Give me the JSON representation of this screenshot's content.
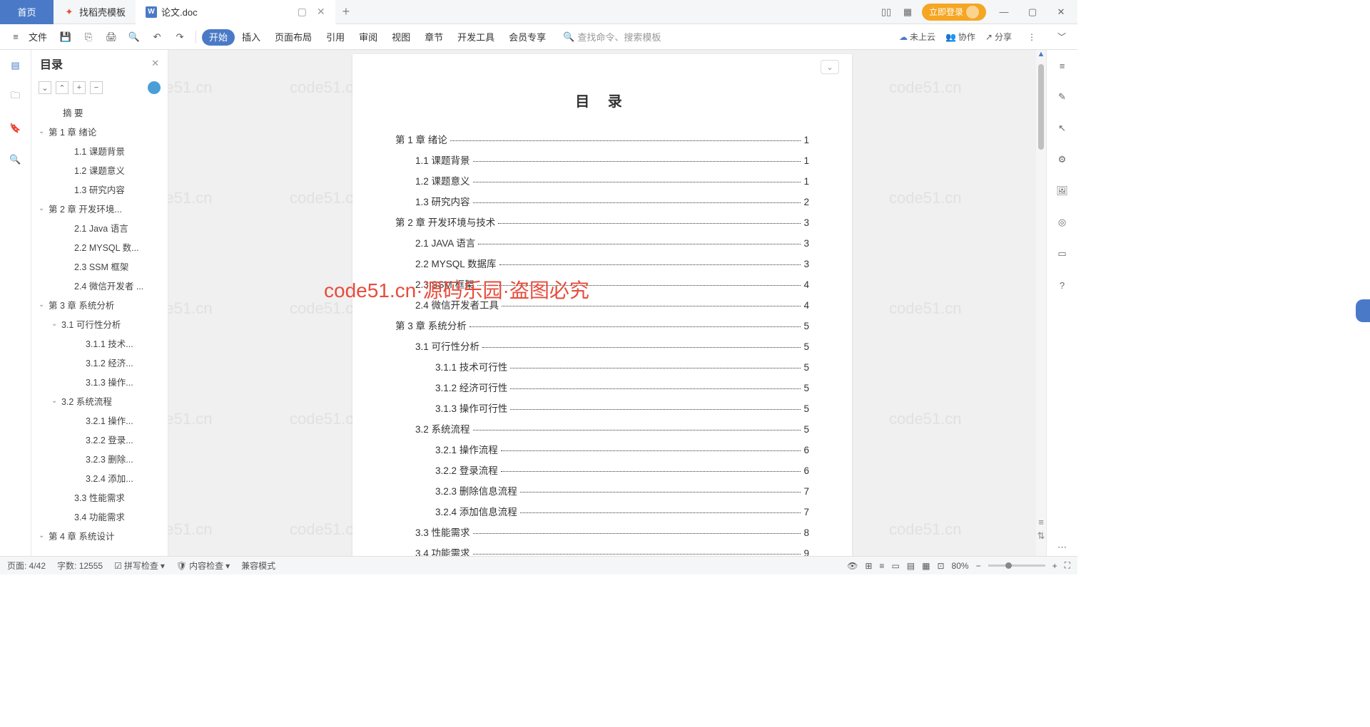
{
  "tabs": {
    "home": "首页",
    "template": "找稻壳模板",
    "doc": "论文.doc"
  },
  "login_label": "立即登录",
  "file_label": "文件",
  "menu": [
    "开始",
    "插入",
    "页面布局",
    "引用",
    "审阅",
    "视图",
    "章节",
    "开发工具",
    "会员专享"
  ],
  "search_placeholder": "查找命令、搜索模板",
  "cloud_label": "未上云",
  "collab_label": "协作",
  "share_label": "分享",
  "outline_title": "目录",
  "outline": [
    {
      "t": "摘 要",
      "l": 1
    },
    {
      "t": "第 1 章  绪论",
      "l": 0,
      "c": true
    },
    {
      "t": "1.1 课题背景",
      "l": 2
    },
    {
      "t": "1.2 课题意义",
      "l": 2
    },
    {
      "t": "1.3 研究内容",
      "l": 2
    },
    {
      "t": "第 2 章  开发环境...",
      "l": 0,
      "c": true
    },
    {
      "t": "2.1 Java 语言",
      "l": 2
    },
    {
      "t": "2.2 MYSQL 数...",
      "l": 2
    },
    {
      "t": "2.3 SSM 框架",
      "l": 2
    },
    {
      "t": "2.4 微信开发者 ...",
      "l": 2
    },
    {
      "t": "第 3 章  系统分析",
      "l": 0,
      "c": true
    },
    {
      "t": "3.1 可行性分析",
      "l": 1,
      "c": true
    },
    {
      "t": "3.1.1 技术...",
      "l": 3
    },
    {
      "t": "3.1.2 经济...",
      "l": 3
    },
    {
      "t": "3.1.3 操作...",
      "l": 3
    },
    {
      "t": "3.2 系统流程",
      "l": 1,
      "c": true
    },
    {
      "t": "3.2.1 操作...",
      "l": 3
    },
    {
      "t": "3.2.2 登录...",
      "l": 3
    },
    {
      "t": "3.2.3 删除...",
      "l": 3
    },
    {
      "t": "3.2.4 添加...",
      "l": 3
    },
    {
      "t": "3.3 性能需求",
      "l": 2
    },
    {
      "t": "3.4 功能需求",
      "l": 2
    },
    {
      "t": "第 4 章  系统设计",
      "l": 0,
      "c": true
    }
  ],
  "toc_title": "目  录",
  "toc": [
    {
      "t": "第 1 章  绪论",
      "p": "1",
      "l": 0
    },
    {
      "t": "1.1 课题背景",
      "p": "1",
      "l": 1
    },
    {
      "t": "1.2 课题意义",
      "p": "1",
      "l": 1
    },
    {
      "t": "1.3 研究内容",
      "p": "2",
      "l": 1
    },
    {
      "t": "第 2 章  开发环境与技术",
      "p": "3",
      "l": 0
    },
    {
      "t": "2.1 JAVA 语言",
      "p": "3",
      "l": 1
    },
    {
      "t": "2.2 MYSQL 数据库",
      "p": "3",
      "l": 1
    },
    {
      "t": "2.3 SSM 框架",
      "p": "4",
      "l": 1
    },
    {
      "t": "2.4 微信开发者工具",
      "p": "4",
      "l": 1
    },
    {
      "t": "第 3 章  系统分析",
      "p": "5",
      "l": 0
    },
    {
      "t": "3.1 可行性分析",
      "p": "5",
      "l": 1
    },
    {
      "t": "3.1.1 技术可行性",
      "p": "5",
      "l": 2
    },
    {
      "t": "3.1.2 经济可行性",
      "p": "5",
      "l": 2
    },
    {
      "t": "3.1.3 操作可行性",
      "p": "5",
      "l": 2
    },
    {
      "t": "3.2 系统流程",
      "p": "5",
      "l": 1
    },
    {
      "t": "3.2.1 操作流程",
      "p": "6",
      "l": 2
    },
    {
      "t": "3.2.2 登录流程",
      "p": "6",
      "l": 2
    },
    {
      "t": "3.2.3 删除信息流程",
      "p": "7",
      "l": 2
    },
    {
      "t": "3.2.4 添加信息流程",
      "p": "7",
      "l": 2
    },
    {
      "t": "3.3 性能需求",
      "p": "8",
      "l": 1
    },
    {
      "t": "3.4 功能需求",
      "p": "9",
      "l": 1
    }
  ],
  "watermark_main": "code51.cn·源码乐园·盗图必究",
  "watermark_bg": "code51.cn",
  "status": {
    "page": "页面: 4/42",
    "words": "字数: 12555",
    "spell": "拼写检查",
    "content": "内容检查",
    "compat": "兼容模式",
    "zoom": "80%"
  }
}
